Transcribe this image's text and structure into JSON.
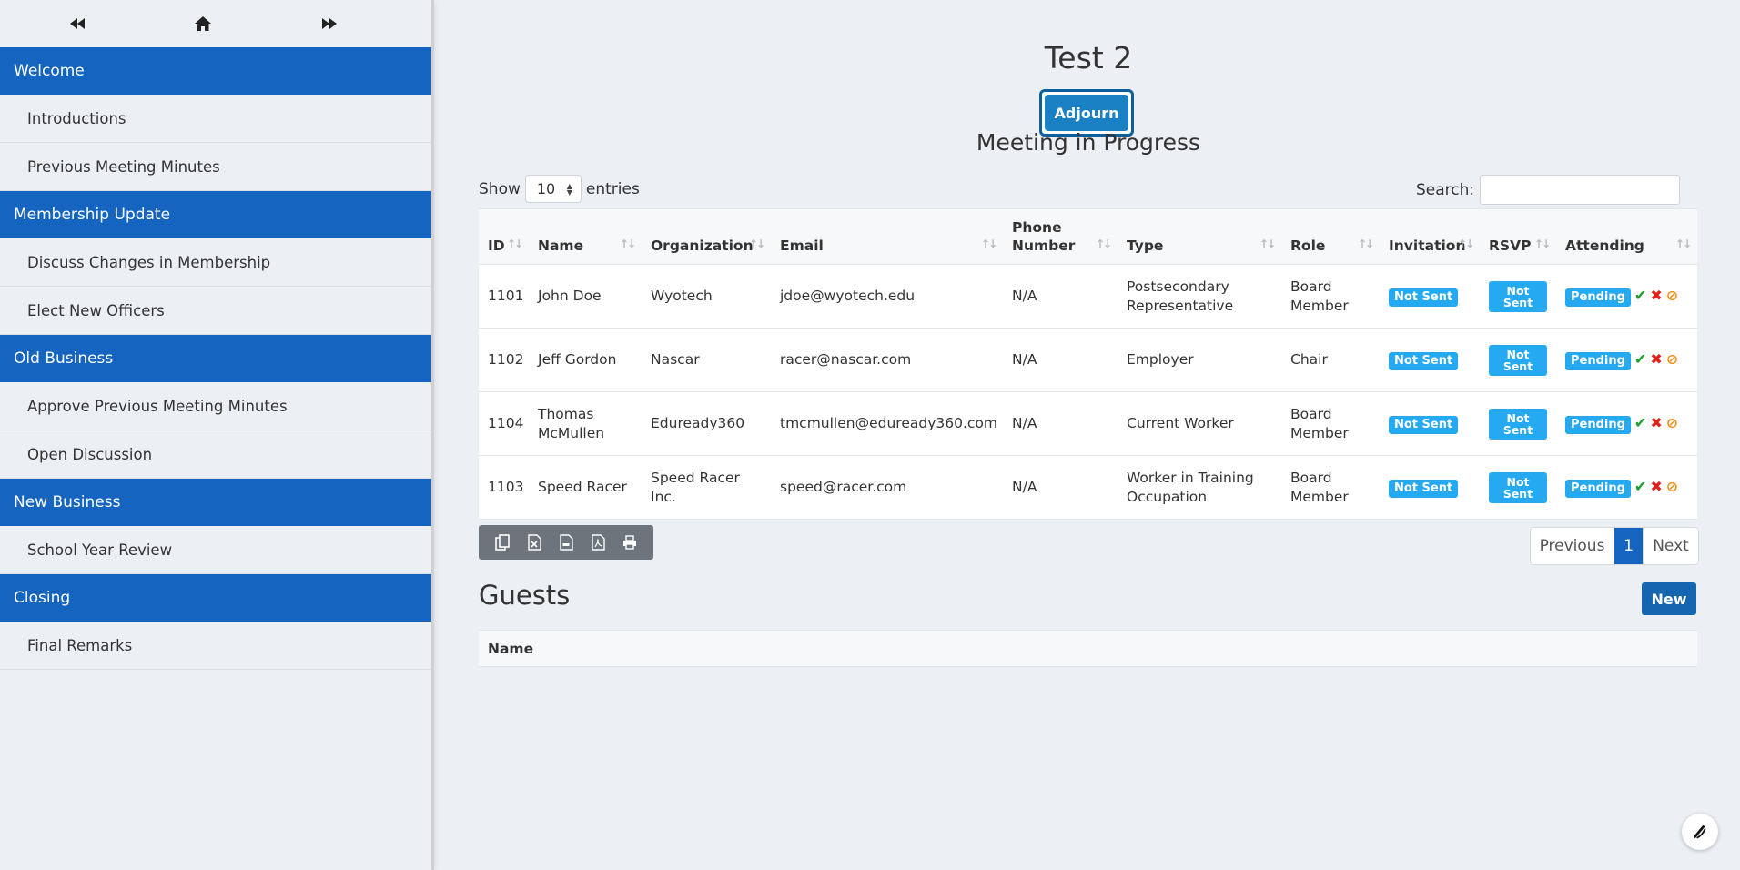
{
  "sidebar": {
    "nav": {
      "prev_icon": "backward-icon",
      "home_icon": "home-icon",
      "next_icon": "forward-icon"
    },
    "sections": [
      {
        "title": "Welcome",
        "items": [
          "Introductions",
          "Previous Meeting Minutes"
        ]
      },
      {
        "title": "Membership Update",
        "items": [
          "Discuss Changes in Membership",
          "Elect New Officers"
        ]
      },
      {
        "title": "Old Business",
        "items": [
          "Approve Previous Meeting Minutes",
          "Open Discussion"
        ]
      },
      {
        "title": "New Business",
        "items": [
          "School Year Review"
        ]
      },
      {
        "title": "Closing",
        "items": [
          "Final Remarks"
        ]
      }
    ]
  },
  "main": {
    "title": "Test 2",
    "adjourn_label": "Adjourn",
    "status": "Meeting in Progress",
    "show_label": "Show",
    "entries_value": "10",
    "entries_label": "entries",
    "search_label": "Search:",
    "search_value": "",
    "columns": [
      "ID",
      "Name",
      "Organization",
      "Email",
      "Phone Number",
      "Type",
      "Role",
      "Invitation",
      "RSVP",
      "Attending"
    ],
    "rows": [
      {
        "id": "1101",
        "name": "John Doe",
        "organization": "Wyotech",
        "email": "jdoe@wyotech.edu",
        "phone": "N/A",
        "type": "Postsecondary Representative",
        "role": "Board Member",
        "invitation": "Not Sent",
        "rsvp": "Not Sent",
        "attending": "Pending"
      },
      {
        "id": "1102",
        "name": "Jeff Gordon",
        "organization": "Nascar",
        "email": "racer@nascar.com",
        "phone": "N/A",
        "type": "Employer",
        "role": "Chair",
        "invitation": "Not Sent",
        "rsvp": "Not Sent",
        "attending": "Pending"
      },
      {
        "id": "1104",
        "name": "Thomas McMullen",
        "organization": "Eduready360",
        "email": "tmcmullen@eduready360.com",
        "phone": "N/A",
        "type": "Current Worker",
        "role": "Board Member",
        "invitation": "Not Sent",
        "rsvp": "Not Sent",
        "attending": "Pending"
      },
      {
        "id": "1103",
        "name": "Speed Racer",
        "organization": "Speed Racer Inc.",
        "email": "speed@racer.com",
        "phone": "N/A",
        "type": "Worker in Training Occupation",
        "role": "Board Member",
        "invitation": "Not Sent",
        "rsvp": "Not Sent",
        "attending": "Pending"
      }
    ],
    "export_icons": [
      "copy-icon",
      "excel-icon",
      "csv-icon",
      "pdf-icon",
      "print-icon"
    ],
    "pager": {
      "prev": "Previous",
      "current": "1",
      "next": "Next"
    },
    "guests_title": "Guests",
    "new_label": "New",
    "guests_columns": [
      "Name"
    ]
  },
  "colors": {
    "accent": "#1565c0",
    "badge": "#25a9f0",
    "check": "#1a9e2c",
    "cross": "#e0201b",
    "ban": "#f0901e"
  }
}
